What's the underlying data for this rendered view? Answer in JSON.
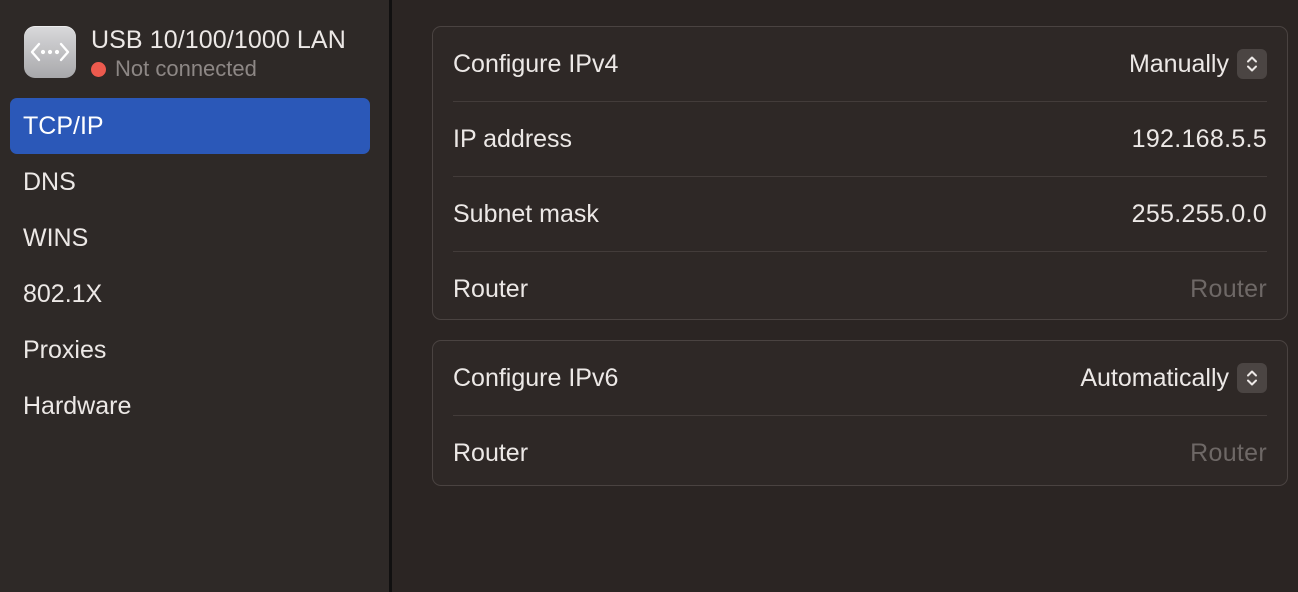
{
  "sidebar": {
    "interface": {
      "name": "USB 10/100/1000 LAN",
      "status": "Not connected",
      "status_color": "#ec5a4e",
      "icon": "ethernet-arrows-icon"
    },
    "items": [
      {
        "label": "TCP/IP",
        "selected": true
      },
      {
        "label": "DNS",
        "selected": false
      },
      {
        "label": "WINS",
        "selected": false
      },
      {
        "label": "802.1X",
        "selected": false
      },
      {
        "label": "Proxies",
        "selected": false
      },
      {
        "label": "Hardware",
        "selected": false
      }
    ],
    "selected_color": "#2b58b8"
  },
  "ipv4": {
    "configure_label": "Configure IPv4",
    "configure_value": "Manually",
    "ip_label": "IP address",
    "ip_value": "192.168.5.5",
    "subnet_label": "Subnet mask",
    "subnet_value": "255.255.0.0",
    "router_label": "Router",
    "router_placeholder": "Router"
  },
  "ipv6": {
    "configure_label": "Configure IPv6",
    "configure_value": "Automatically",
    "router_label": "Router",
    "router_placeholder": "Router"
  }
}
